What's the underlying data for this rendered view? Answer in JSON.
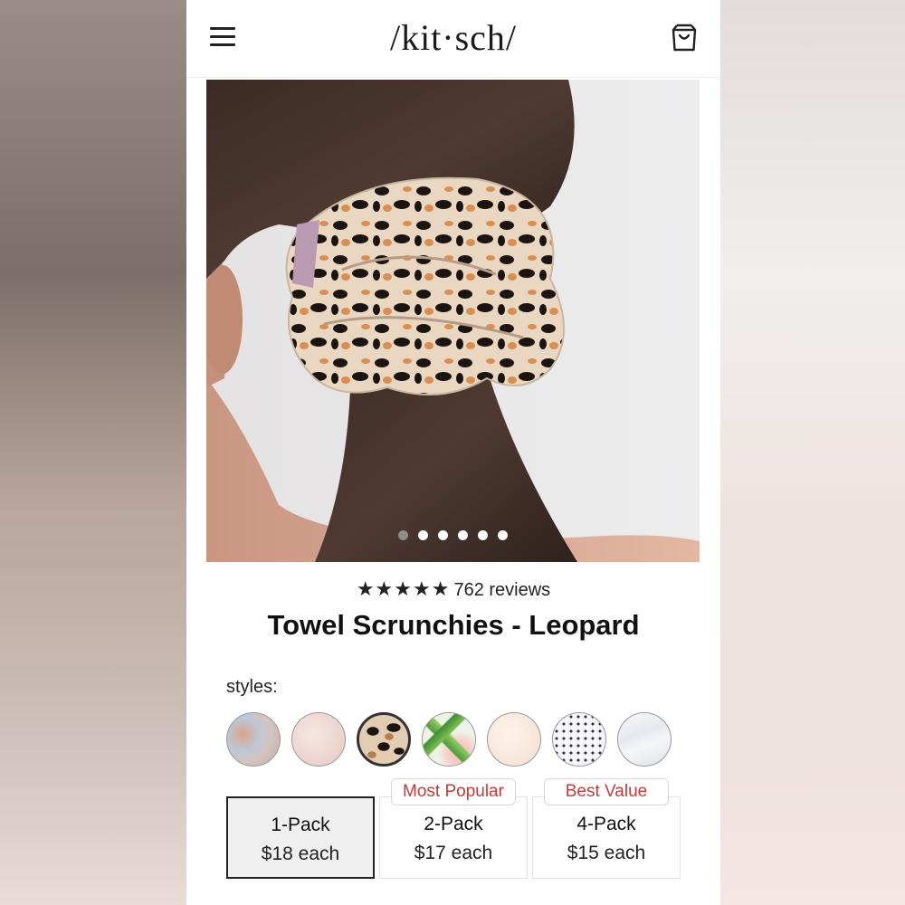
{
  "header": {
    "logo": "/kit·sch/",
    "menu_icon": "hamburger-menu-icon",
    "cart_icon": "shopping-bag-icon"
  },
  "gallery": {
    "image_subject": "leopard towel scrunchie in ponytail",
    "total_slides": 6,
    "active_slide": 1
  },
  "product": {
    "stars": "★★★★★",
    "reviews_text": "762 reviews",
    "title": "Towel Scrunchies - Leopard"
  },
  "styles": {
    "label": "styles:",
    "swatches": [
      {
        "name": "tie-dye",
        "color": "#c9b8b2",
        "selected": false
      },
      {
        "name": "blush",
        "color": "#f1dcd6",
        "selected": false
      },
      {
        "name": "leopard",
        "color": "#d6b895",
        "selected": true
      },
      {
        "name": "palm-leaf",
        "color": "#6fae4e",
        "selected": false
      },
      {
        "name": "cream",
        "color": "#f8e9dc",
        "selected": false
      },
      {
        "name": "polka-dot",
        "color": "#f4f4f6",
        "selected": false
      },
      {
        "name": "marble",
        "color": "#eef0f3",
        "selected": false
      }
    ]
  },
  "packs": [
    {
      "name": "1-Pack",
      "price": "$18 each",
      "badge": "",
      "selected": true
    },
    {
      "name": "2-Pack",
      "price": "$17 each",
      "badge": "Most Popular",
      "selected": false
    },
    {
      "name": "4-Pack",
      "price": "$15 each",
      "badge": "Best Value",
      "selected": false
    }
  ],
  "colors": {
    "badge_text": "#c63a3a",
    "selected_border": "#222222"
  }
}
